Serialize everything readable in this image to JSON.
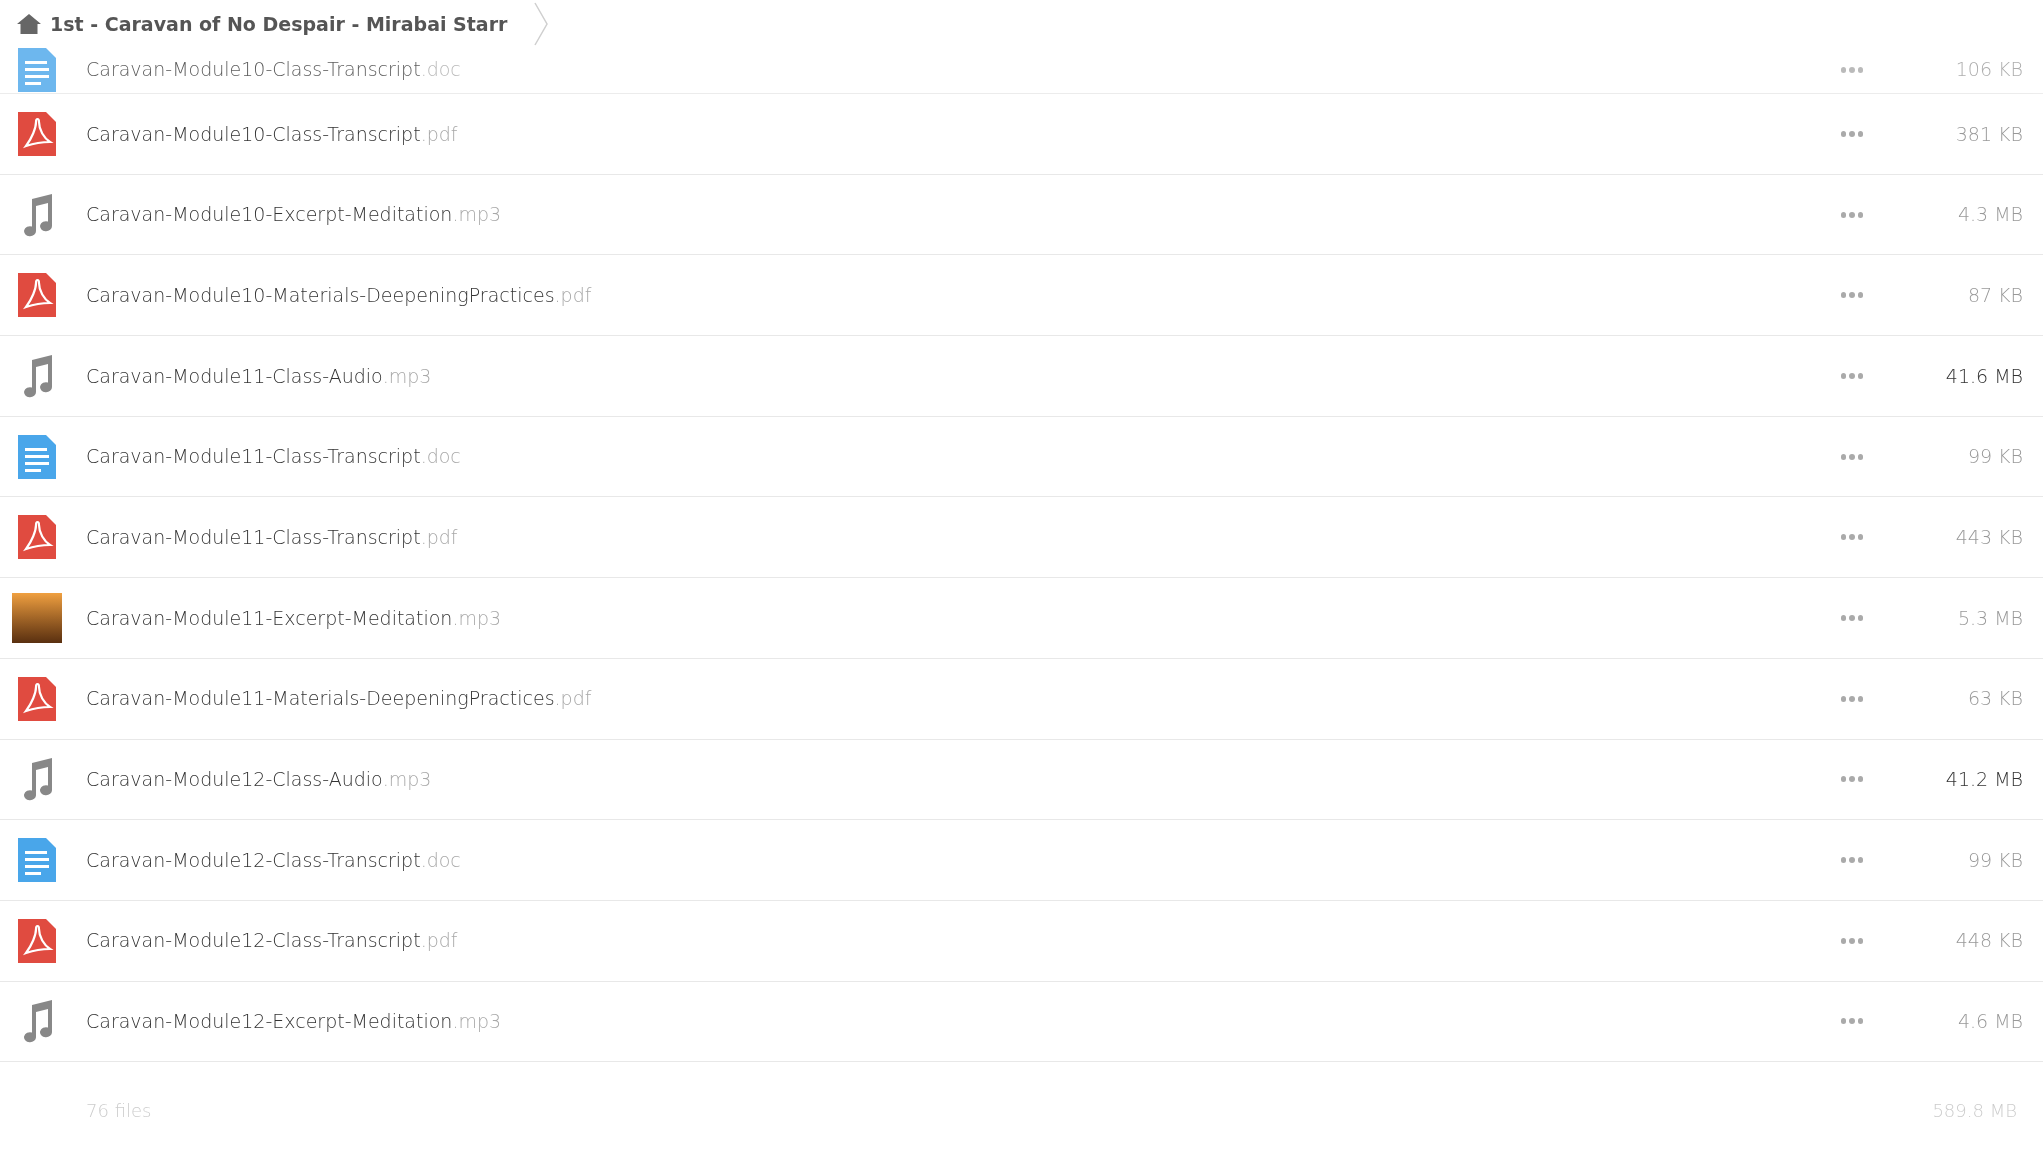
{
  "breadcrumb": {
    "title": "1st - Caravan of No Despair - Mirabai Starr"
  },
  "files": [
    {
      "kind": "doc",
      "name": "Caravan-Module10-Class-Transcript",
      "ext": ".doc",
      "size": "106 KB",
      "faded": true,
      "highlight": false
    },
    {
      "kind": "pdf",
      "name": "Caravan-Module10-Class-Transcript",
      "ext": ".pdf",
      "size": "381 KB",
      "faded": false,
      "highlight": false
    },
    {
      "kind": "audio",
      "name": "Caravan-Module10-Excerpt-Meditation",
      "ext": ".mp3",
      "size": "4.3 MB",
      "faded": false,
      "highlight": false
    },
    {
      "kind": "pdf",
      "name": "Caravan-Module10-Materials-DeepeningPractices",
      "ext": ".pdf",
      "size": "87 KB",
      "faded": false,
      "highlight": false
    },
    {
      "kind": "audio",
      "name": "Caravan-Module11-Class-Audio",
      "ext": ".mp3",
      "size": "41.6 MB",
      "faded": false,
      "highlight": true
    },
    {
      "kind": "doc",
      "name": "Caravan-Module11-Class-Transcript",
      "ext": ".doc",
      "size": "99 KB",
      "faded": false,
      "highlight": false
    },
    {
      "kind": "pdf",
      "name": "Caravan-Module11-Class-Transcript",
      "ext": ".pdf",
      "size": "443 KB",
      "faded": false,
      "highlight": false
    },
    {
      "kind": "thumbnail",
      "name": "Caravan-Module11-Excerpt-Meditation",
      "ext": ".mp3",
      "size": "5.3 MB",
      "faded": false,
      "highlight": false
    },
    {
      "kind": "pdf",
      "name": "Caravan-Module11-Materials-DeepeningPractices",
      "ext": ".pdf",
      "size": "63 KB",
      "faded": false,
      "highlight": false
    },
    {
      "kind": "audio",
      "name": "Caravan-Module12-Class-Audio",
      "ext": ".mp3",
      "size": "41.2 MB",
      "faded": false,
      "highlight": true
    },
    {
      "kind": "doc",
      "name": "Caravan-Module12-Class-Transcript",
      "ext": ".doc",
      "size": "99 KB",
      "faded": false,
      "highlight": false
    },
    {
      "kind": "pdf",
      "name": "Caravan-Module12-Class-Transcript",
      "ext": ".pdf",
      "size": "448 KB",
      "faded": false,
      "highlight": false
    },
    {
      "kind": "audio",
      "name": "Caravan-Module12-Excerpt-Meditation",
      "ext": ".mp3",
      "size": "4.6 MB",
      "faded": false,
      "highlight": false
    }
  ],
  "footer": {
    "count": "76 files",
    "total": "589.8 MB"
  }
}
